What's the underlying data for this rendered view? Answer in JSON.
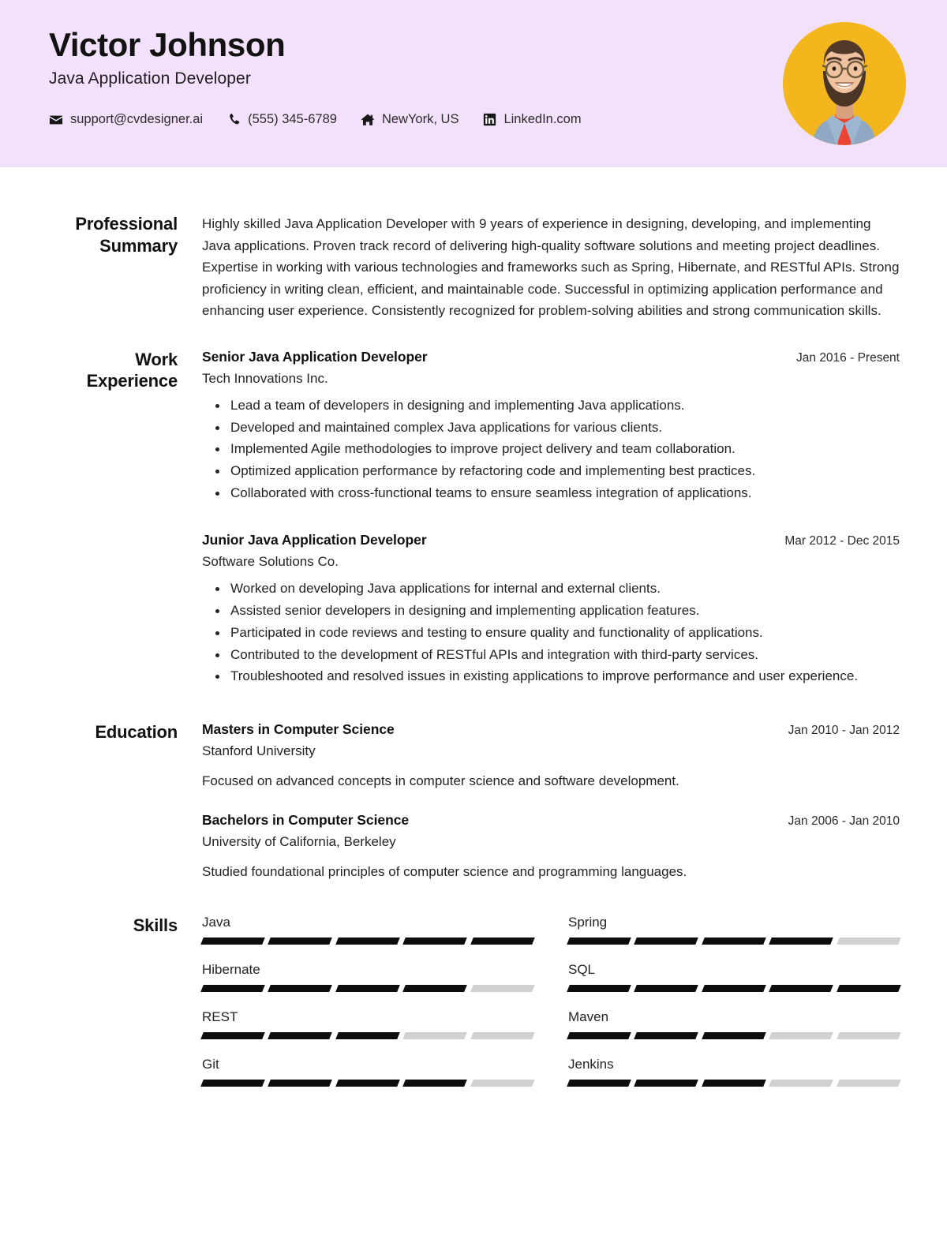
{
  "theme": {
    "header_bg": "#f3e1fc",
    "avatar_bg": "#f3b61c",
    "skill_filled": "#0d0d0d",
    "skill_empty": "#d1d1d1",
    "text": "#232323"
  },
  "header": {
    "name": "Victor Johnson",
    "title": "Java Application Developer",
    "contacts": [
      {
        "icon": "envelope-icon",
        "label": "support@cvdesigner.ai"
      },
      {
        "icon": "phone-icon",
        "label": "(555) 345-6789"
      },
      {
        "icon": "home-icon",
        "label": "NewYork, US"
      },
      {
        "icon": "linkedin-icon",
        "label": "LinkedIn.com"
      }
    ]
  },
  "summary": {
    "label": "Professional Summary",
    "text": "Highly skilled Java Application Developer with 9 years of experience in designing, developing, and implementing Java applications. Proven track record of delivering high-quality software solutions and meeting project deadlines. Expertise in working with various technologies and frameworks such as Spring, Hibernate, and RESTful APIs. Strong proficiency in writing clean, efficient, and maintainable code. Successful in optimizing application performance and enhancing user experience. Consistently recognized for problem-solving abilities and strong communication skills."
  },
  "work": {
    "label": "Work Experience",
    "entries": [
      {
        "role": "Senior Java Application Developer",
        "dates": "Jan 2016 - Present",
        "org": "Tech Innovations Inc.",
        "bullets": [
          "Lead a team of developers in designing and implementing Java applications.",
          "Developed and maintained complex Java applications for various clients.",
          "Implemented Agile methodologies to improve project delivery and team collaboration.",
          "Optimized application performance by refactoring code and implementing best practices.",
          "Collaborated with cross-functional teams to ensure seamless integration of applications."
        ]
      },
      {
        "role": "Junior Java Application Developer",
        "dates": "Mar 2012 - Dec 2015",
        "org": "Software Solutions Co.",
        "bullets": [
          "Worked on developing Java applications for internal and external clients.",
          "Assisted senior developers in designing and implementing application features.",
          "Participated in code reviews and testing to ensure quality and functionality of applications.",
          "Contributed to the development of RESTful APIs and integration with third-party services.",
          "Troubleshooted and resolved issues in existing applications to improve performance and user experience."
        ]
      }
    ]
  },
  "education": {
    "label": "Education",
    "entries": [
      {
        "degree": "Masters in Computer Science",
        "dates": "Jan 2010 - Jan 2012",
        "school": "Stanford University",
        "description": "Focused on advanced concepts in computer science and software development."
      },
      {
        "degree": "Bachelors in Computer Science",
        "dates": "Jan 2006 - Jan 2010",
        "school": "University of California, Berkeley",
        "description": "Studied foundational principles of computer science and programming languages."
      }
    ]
  },
  "skills": {
    "label": "Skills",
    "max_level": 5,
    "items": [
      {
        "name": "Java",
        "level": 5
      },
      {
        "name": "Spring",
        "level": 4
      },
      {
        "name": "Hibernate",
        "level": 4
      },
      {
        "name": "SQL",
        "level": 5
      },
      {
        "name": "REST",
        "level": 3
      },
      {
        "name": "Maven",
        "level": 3
      },
      {
        "name": "Git",
        "level": 4
      },
      {
        "name": "Jenkins",
        "level": 3
      }
    ]
  }
}
